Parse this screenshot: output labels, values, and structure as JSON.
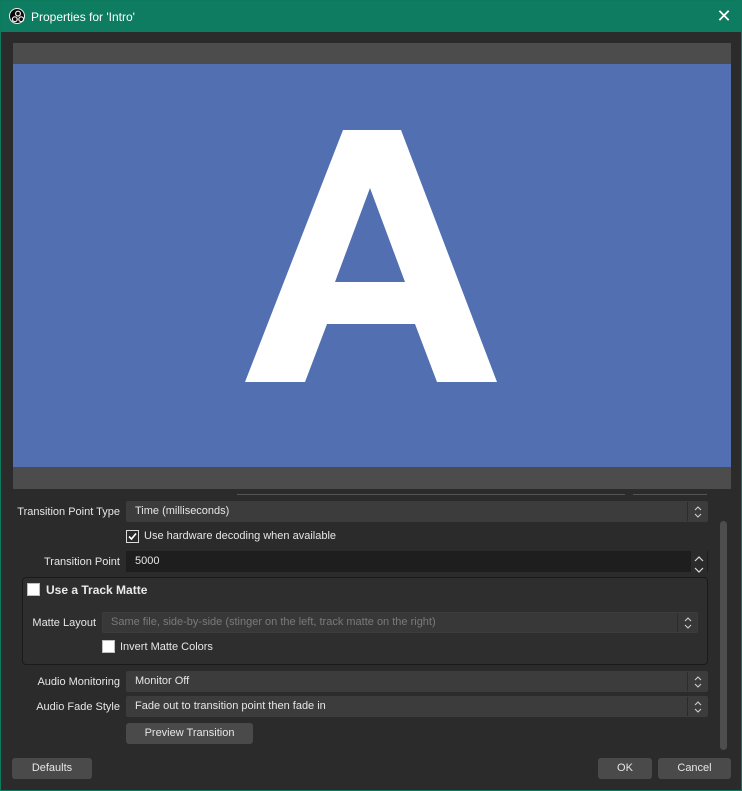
{
  "window": {
    "title": "Properties for 'Intro'",
    "close_glyph": "✕",
    "app_icon": "obs-icon",
    "accent_color": "#0e7c60"
  },
  "preview": {
    "background_color": "#526fb1",
    "glyph": "A",
    "glyph_color": "#ffffff"
  },
  "form": {
    "transition_point_type": {
      "label": "Transition Point Type",
      "value": "Time (milliseconds)"
    },
    "hardware_decoding": {
      "label": "Use hardware decoding when available",
      "checked": true
    },
    "transition_point": {
      "label": "Transition Point",
      "value": "5000"
    },
    "track_matte": {
      "title": "Use a Track Matte",
      "checked": false,
      "matte_layout": {
        "label": "Matte Layout",
        "value": "Same file, side-by-side (stinger on the left, track matte on the right)"
      },
      "invert_colors": {
        "label": "Invert Matte Colors",
        "checked": false
      }
    },
    "audio_monitoring": {
      "label": "Audio Monitoring",
      "value": "Monitor Off"
    },
    "audio_fade_style": {
      "label": "Audio Fade Style",
      "value": "Fade out to transition point then fade in"
    },
    "preview_button": "Preview Transition"
  },
  "footer": {
    "defaults_button": "Defaults",
    "ok_button": "OK",
    "cancel_button": "Cancel"
  }
}
